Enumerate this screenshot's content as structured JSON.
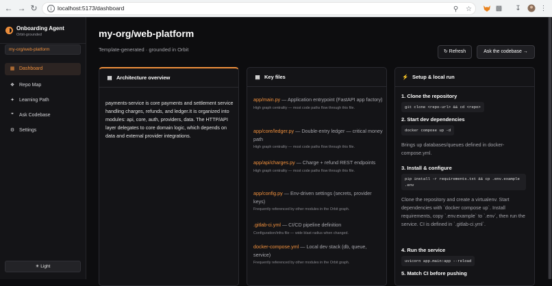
{
  "browser": {
    "url": "localhost:5173/dashboard"
  },
  "sidebar": {
    "brand": {
      "name": "Onboarding Agent",
      "subtitle": "Orbit-grounded"
    },
    "repo": "my-org/web-platform",
    "nav": [
      {
        "label": "Dashboard",
        "icon": "grid-icon",
        "active": true
      },
      {
        "label": "Repo Map",
        "icon": "map-icon",
        "active": false
      },
      {
        "label": "Learning Path",
        "icon": "sparkle-icon",
        "active": false
      },
      {
        "label": "Ask Codebase",
        "icon": "chat-icon",
        "active": false
      },
      {
        "label": "Settings",
        "icon": "gear-icon",
        "active": false
      }
    ],
    "theme_toggle": "Light"
  },
  "header": {
    "title": "my-org/web-platform",
    "subtitle": "Template-generated · grounded in Orbit",
    "refresh_label": "Refresh",
    "ask_label": "Ask the codebase →"
  },
  "architecture": {
    "title": "Architecture overview",
    "body": "payments-service is core payments and settlement service handling charges, refunds, and ledger.It is organized into modules: api, core, auth, providers, data. The HTTP/API layer delegates to core domain logic, which depends on data and external provider integrations."
  },
  "key_files": {
    "title": "Key files",
    "items": [
      {
        "path": "app/main.py",
        "desc": " — Application entrypoint (FastAPI app factory)",
        "note": "High graph centrality — most code paths flow through this file."
      },
      {
        "path": "app/core/ledger.py",
        "desc": " — Double-entry ledger — critical money path",
        "note": "High graph centrality — most code paths flow through this file."
      },
      {
        "path": "app/api/charges.py",
        "desc": " — Charge + refund REST endpoints",
        "note": "High graph centrality — most code paths flow through this file."
      },
      {
        "path": "app/config.py",
        "desc": " — Env-driven settings (secrets, provider keys)",
        "note": "Frequently referenced by other modules in the Orbit graph."
      },
      {
        "path": ".gitlab-ci.yml",
        "desc": " — CI/CD pipeline definition",
        "note": "Configuration/infra file — wide blast radius when changed."
      },
      {
        "path": "docker-compose.yml",
        "desc": " — Local dev stack (db, queue, service)",
        "note": "Frequently referenced by other modules in the Orbit graph."
      }
    ]
  },
  "setup": {
    "title": "Setup & local run",
    "steps": [
      {
        "title": "1. Clone the repository",
        "code": "git clone <repo-url> && cd <repo>"
      },
      {
        "title": "2. Start dev dependencies",
        "code": "docker compose up -d",
        "desc": "Brings up databases/queues defined in docker-compose.yml."
      },
      {
        "title": "3. Install & configure",
        "code": "pip install -r requirements.txt && cp .env.example .env",
        "desc": "Clone the repository and create a virtualenv. Start dependencies with `docker compose up`. Install requirements, copy `.env.example` to `.env`, then run the service. CI is defined in `.gitlab-ci.yml`."
      },
      {
        "title": "4. Run the service",
        "code": "uvicorn app.main:app --reload"
      },
      {
        "title": "5. Match CI before pushing"
      }
    ]
  }
}
